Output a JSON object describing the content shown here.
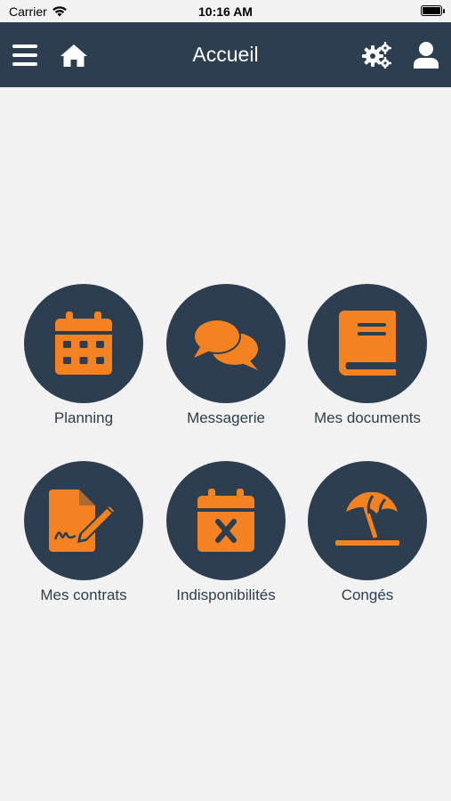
{
  "status": {
    "carrier": "Carrier",
    "time": "10:16 AM"
  },
  "header": {
    "title": "Accueil",
    "background": "#2c3e50"
  },
  "accent": "#f58220",
  "tiles": [
    {
      "label": "Planning",
      "icon": "calendar-icon"
    },
    {
      "label": "Messagerie",
      "icon": "chat-bubbles-icon"
    },
    {
      "label": "Mes documents",
      "icon": "book-icon"
    },
    {
      "label": "Mes contrats",
      "icon": "signed-document-icon"
    },
    {
      "label": "Indisponibilités",
      "icon": "calendar-x-icon"
    },
    {
      "label": "Congés",
      "icon": "beach-umbrella-icon"
    }
  ]
}
